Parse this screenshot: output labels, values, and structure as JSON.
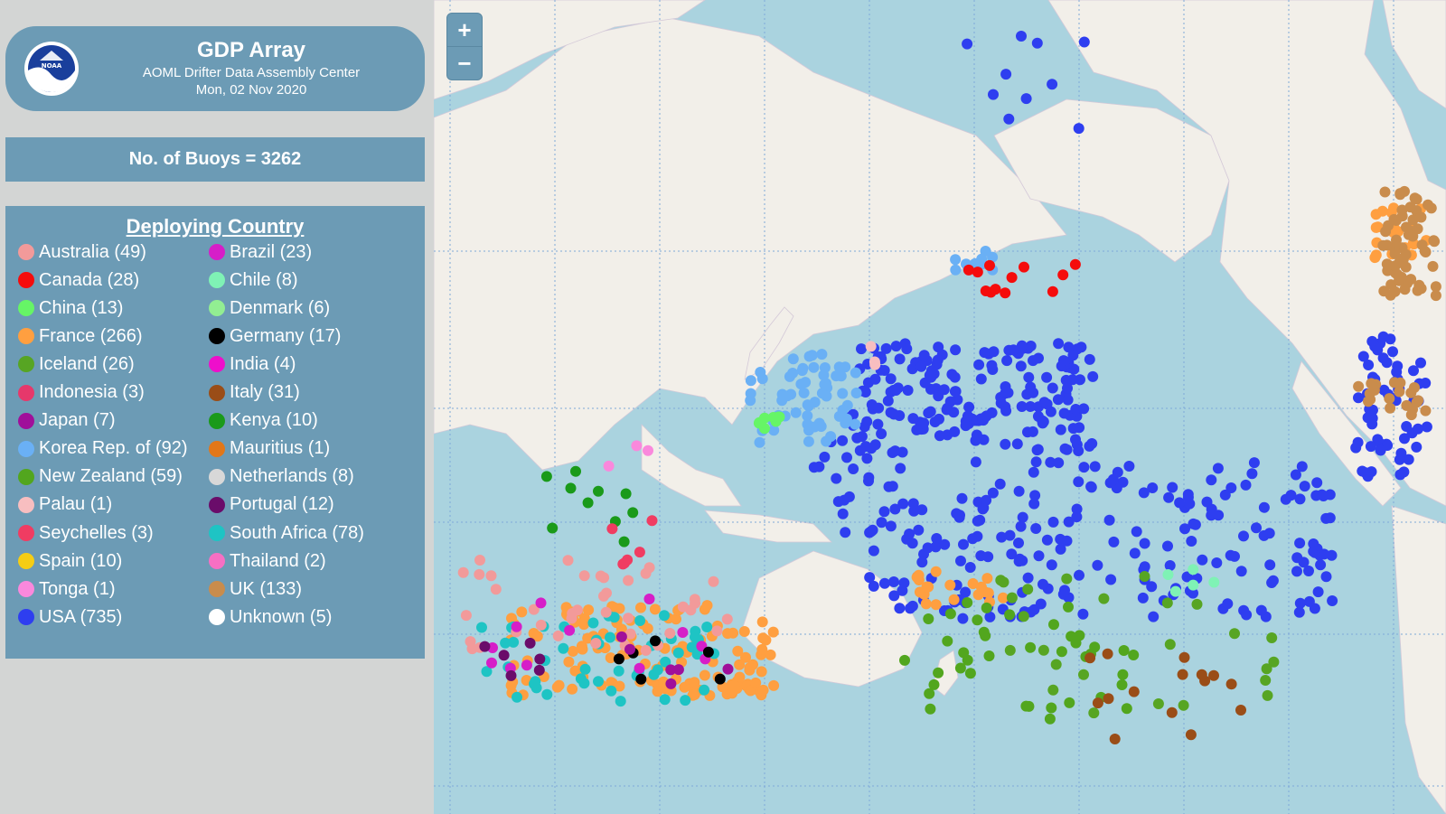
{
  "header": {
    "title": "GDP Array",
    "subtitle": "AOML Drifter Data Assembly Center",
    "date": "Mon, 02 Nov 2020"
  },
  "stats": {
    "buoy_count_text": "No. of Buoys = 3262"
  },
  "legend": {
    "title": "Deploying Country",
    "items": [
      {
        "label": "Australia (49)",
        "color": "#f29a9a"
      },
      {
        "label": "Brazil (23)",
        "color": "#d61ec8"
      },
      {
        "label": "Canada (28)",
        "color": "#f50c0c"
      },
      {
        "label": "Chile (8)",
        "color": "#7ff2b5"
      },
      {
        "label": "China (13)",
        "color": "#66f566"
      },
      {
        "label": "Denmark (6)",
        "color": "#92ee92"
      },
      {
        "label": "France (266)",
        "color": "#ff9f40"
      },
      {
        "label": "Germany (17)",
        "color": "#000000"
      },
      {
        "label": "Iceland (26)",
        "color": "#57a523"
      },
      {
        "label": "India (4)",
        "color": "#ee0fcb"
      },
      {
        "label": "Indonesia (3)",
        "color": "#e6386b"
      },
      {
        "label": "Italy (31)",
        "color": "#9a4d17"
      },
      {
        "label": "Japan (7)",
        "color": "#a00f9a"
      },
      {
        "label": "Kenya (10)",
        "color": "#1a9a1a"
      },
      {
        "label": "Korea Rep. of (92)",
        "color": "#6ab0f5"
      },
      {
        "label": "Mauritius (1)",
        "color": "#e27719"
      },
      {
        "label": "New Zealand (59)",
        "color": "#52a61e"
      },
      {
        "label": "Netherlands (8)",
        "color": "#d8d8d8"
      },
      {
        "label": "Palau (1)",
        "color": "#f8bec0"
      },
      {
        "label": "Portugal (12)",
        "color": "#6a0c6a"
      },
      {
        "label": "Seychelles (3)",
        "color": "#f03c62"
      },
      {
        "label": "South Africa (78)",
        "color": "#1ec4c4"
      },
      {
        "label": "Spain (10)",
        "color": "#f5cd14"
      },
      {
        "label": "Thailand (2)",
        "color": "#f76fc3"
      },
      {
        "label": "Tonga (1)",
        "color": "#fa88dc"
      },
      {
        "label": "UK (133)",
        "color": "#c98c4c"
      },
      {
        "label": "USA (735)",
        "color": "#2e3ef0"
      },
      {
        "label": "Unknown (5)",
        "color": "#ffffff"
      }
    ]
  },
  "map": {
    "zoom_in_label": "+",
    "zoom_out_label": "−",
    "ocean_color": "#aad3df",
    "land_color": "#f2efe9",
    "logo_name": "noaa-logo"
  }
}
